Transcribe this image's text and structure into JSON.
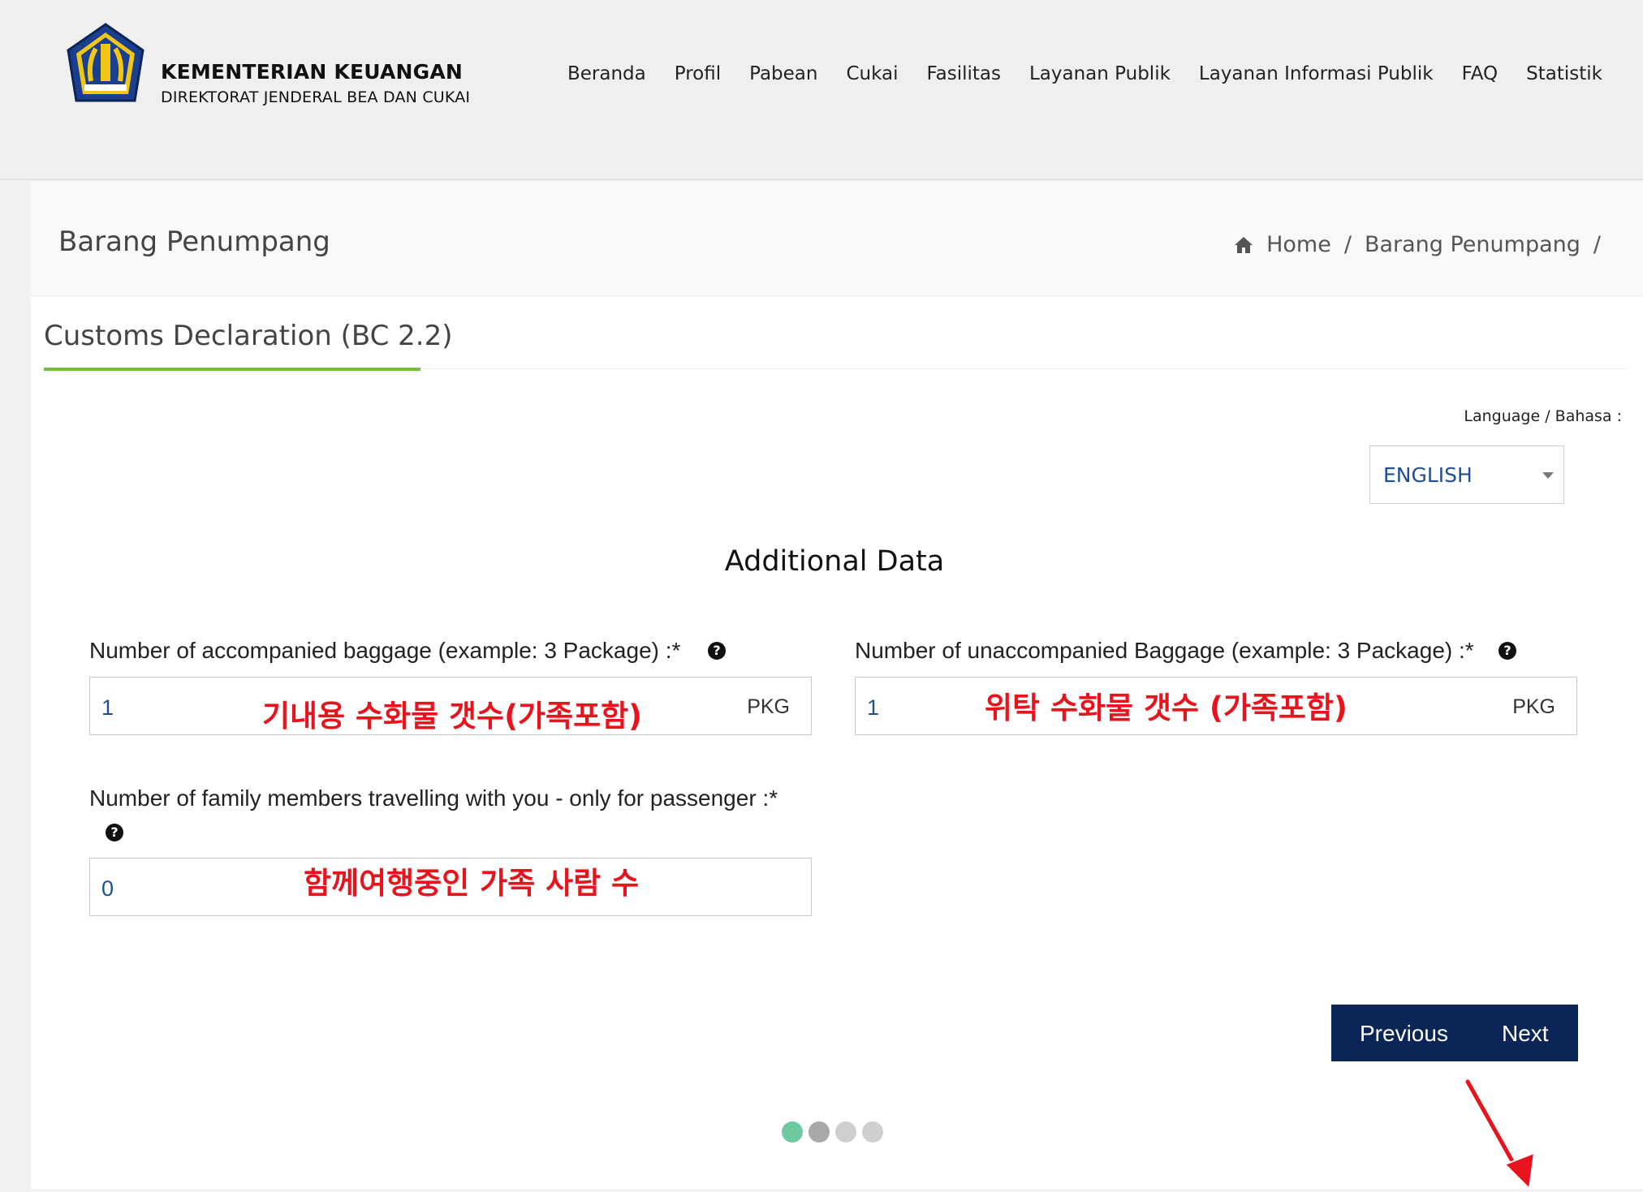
{
  "header": {
    "brand_title": "KEMENTERIAN KEUANGAN",
    "brand_subtitle": "DIREKTORAT JENDERAL BEA DAN CUKAI",
    "nav": [
      "Beranda",
      "Profil",
      "Pabean",
      "Cukai",
      "Fasilitas",
      "Layanan Publik",
      "Layanan Informasi Publik",
      "FAQ",
      "Statistik"
    ]
  },
  "page": {
    "title": "Barang Penumpang",
    "breadcrumb": [
      "Home",
      "Barang Penumpang"
    ],
    "breadcrumb_separator": "/",
    "section_title": "Customs Declaration (BC 2.2)"
  },
  "language": {
    "label": "Language / Bahasa :",
    "selected": "ENGLISH"
  },
  "form": {
    "heading": "Additional Data",
    "accompanied": {
      "label": "Number of accompanied baggage (example: 3 Package) :*",
      "value": "1",
      "unit": "PKG",
      "annotation": "기내용 수화물 갯수(가족포함)"
    },
    "unaccompanied": {
      "label": "Number of unaccompanied Baggage (example: 3 Package) :*",
      "value": "1",
      "unit": "PKG",
      "annotation": "위탁 수화물 갯수 (가족포함)"
    },
    "family": {
      "label": "Number of family members travelling with you - only for passenger :*",
      "value": "0",
      "annotation": "함께여행중인 가족 사람 수"
    },
    "help_icon_glyph": "?"
  },
  "buttons": {
    "previous": "Previous",
    "next": "Next"
  },
  "progress": {
    "total_steps": 4,
    "current_step": 1
  },
  "colors": {
    "brand_navy": "#0b2656",
    "accent_green": "#6fbf3b",
    "annotation_red": "#e8141d",
    "input_value_blue": "#1f4f8f",
    "active_dot": "#6cc9a0",
    "inactive_dot": "#cfcfcf"
  },
  "icons": [
    "logo-emblem",
    "home-icon",
    "help-icon",
    "dropdown-caret-icon",
    "annotation-arrow-icon"
  ]
}
